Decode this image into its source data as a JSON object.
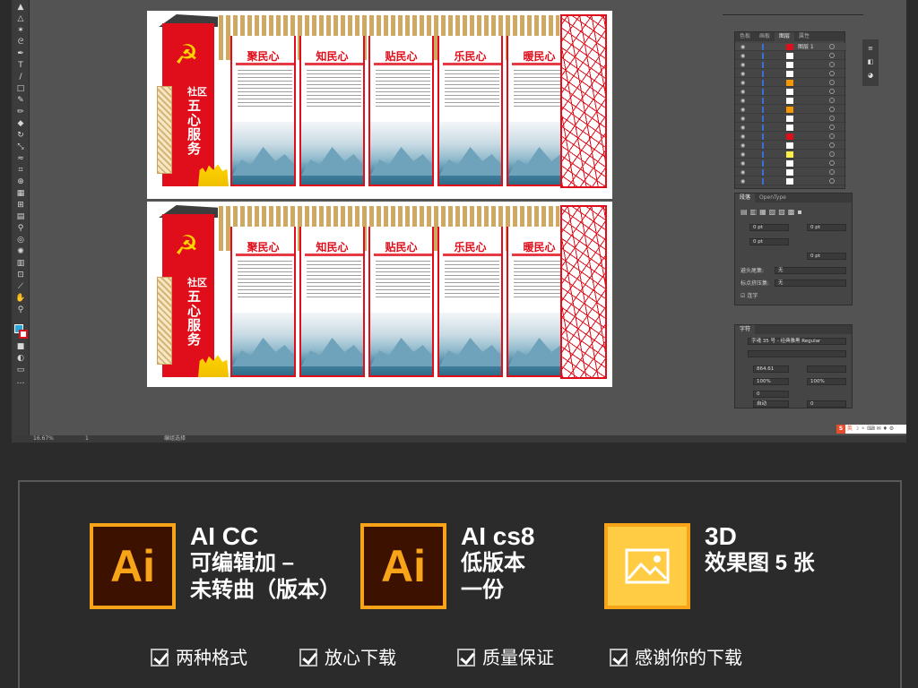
{
  "statusbar": {
    "zoom": "16.67%",
    "artboard_num": "1",
    "mode": "编组选择"
  },
  "artboards": [
    {
      "flag_small": "社区",
      "flag_big": "五心服务",
      "panels": [
        "聚民心",
        "知民心",
        "贴民心",
        "乐民心",
        "暖民心"
      ]
    },
    {
      "flag_small": "社区",
      "flag_big": "五心服务",
      "panels": [
        "聚民心",
        "知民心",
        "贴民心",
        "乐民心",
        "暖民心"
      ]
    }
  ],
  "layers_panel": {
    "tabs": [
      "色板",
      "画板",
      "图层",
      "属性"
    ],
    "active_tab": "图层",
    "top_layer": "图层 1"
  },
  "para_panel": {
    "tabs": [
      "段落",
      "OpenType"
    ],
    "fields": [
      "0 pt",
      "0 pt",
      "0 pt",
      "0 pt"
    ],
    "kinsoku_label": "避头尾集:",
    "kinsoku_value": "无",
    "mojikumi_label": "标点挤压集:",
    "mojikumi_value": "无",
    "hyphen_label": "连字"
  },
  "char_panel": {
    "tab": "字符",
    "font": "字魂 35 号 - 经典雅黑 Regular",
    "size": "864.61",
    "scale_v": "100%",
    "scale_h": "100%",
    "tracking": "0",
    "leading": "自动",
    "baseline": "0"
  },
  "ime": {
    "label": "英"
  },
  "formats": [
    {
      "icon_text": "Ai",
      "title": "AI CC",
      "lines": [
        "可编辑加 –",
        "未转曲（版本）"
      ]
    },
    {
      "icon_text": "Ai",
      "title": "AI cs8",
      "lines": [
        "低版本",
        "一份"
      ]
    },
    {
      "icon_text": "",
      "title": "3D",
      "lines": [
        "效果图 5 张"
      ]
    }
  ],
  "features": [
    "两种格式",
    "放心下载",
    "质量保证",
    "感谢你的下载"
  ],
  "colors": {
    "accent": "#f8a418",
    "party_red": "#e00d1a",
    "ui_dark": "#535353"
  }
}
